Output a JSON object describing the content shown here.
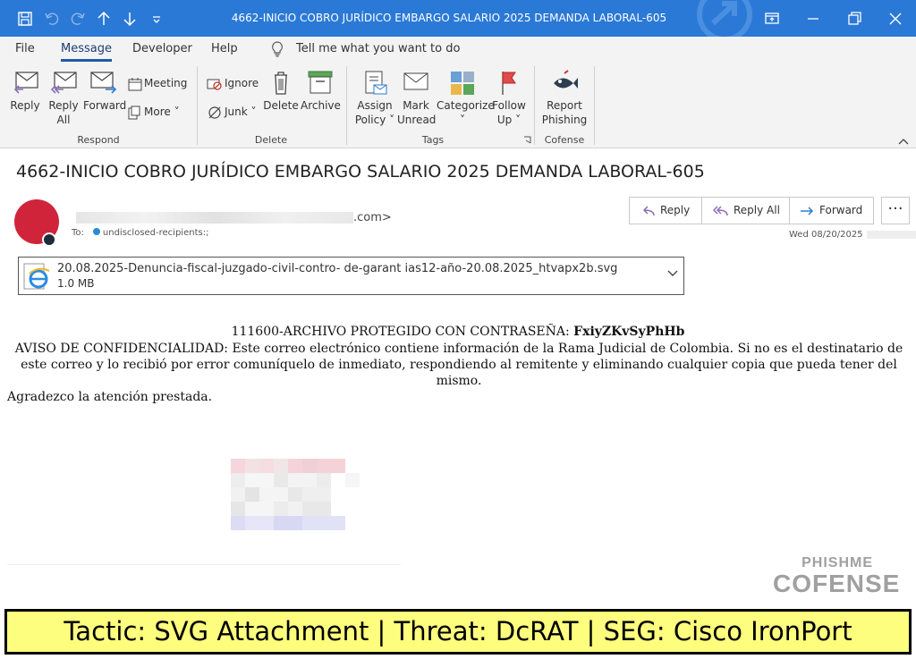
{
  "window": {
    "title": "4662-INICIO COBRO JURÍDICO EMBARGO SALARIO 2025 DEMANDA LABORAL-605"
  },
  "menu": {
    "items": [
      "File",
      "Message",
      "Developer",
      "Help"
    ],
    "active": "Message",
    "tell_me": "Tell me what you want to do"
  },
  "ribbon": {
    "respond": {
      "label": "Respond",
      "reply": "Reply",
      "reply_all_1": "Reply",
      "reply_all_2": "All",
      "forward": "Forward",
      "meeting": "Meeting",
      "more": "More"
    },
    "delete": {
      "label": "Delete",
      "ignore": "Ignore",
      "junk": "Junk",
      "delete": "Delete",
      "archive": "Archive"
    },
    "tags": {
      "label": "Tags",
      "assign_1": "Assign",
      "assign_2": "Policy",
      "mark_1": "Mark",
      "mark_2": "Unread",
      "categorize": "Categorize",
      "follow_1": "Follow",
      "follow_2": "Up"
    },
    "cofense": {
      "label": "Cofense",
      "report_1": "Report",
      "report_2": "Phishing"
    }
  },
  "message": {
    "subject": "4662-INICIO COBRO JURÍDICO EMBARGO SALARIO 2025 DEMANDA LABORAL-605",
    "sender_suffix": ".com>",
    "to_label": "To:",
    "to_value": "undisclosed-recipients:;",
    "date": "Wed 08/20/2025",
    "actions": {
      "reply": "Reply",
      "reply_all": "Reply All",
      "forward": "Forward",
      "more": "···"
    },
    "attachment": {
      "name": "20.08.2025-Denuncia-fiscal-juzgado-civil-contro- de-garant ias12-año-20.08.2025_htvapx2b.svg",
      "size": "1.0 MB"
    },
    "body": {
      "line1_prefix": "111600-ARCHIVO PROTEGIDO CON CONTRASEÑA: ",
      "password": "FxiyZKvSyPhHb",
      "line2": "AVISO DE CONFIDENCIALIDAD: Este correo electrónico contiene información de la Rama Judicial de Colombia. Si no es el destinatario de este correo y lo recibió por error comuníquelo de inmediato, respondiendo al remitente y eliminando cualquier copia que pueda tener del mismo.",
      "line3": "Agradezco la atención prestada."
    }
  },
  "watermark": {
    "top": "PHISHME",
    "bottom": "COFENSE"
  },
  "banner": {
    "text": "Tactic: SVG Attachment | Threat: DcRAT | SEG: Cisco IronPort"
  },
  "colors": {
    "titlebar": "#2b79d6",
    "banner": "#fdfd7e",
    "avatar": "#d0243a"
  }
}
